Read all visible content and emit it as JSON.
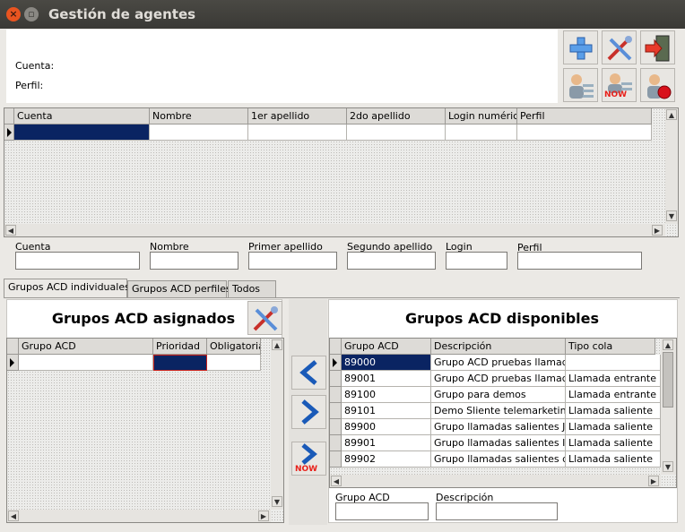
{
  "window": {
    "title": "Gestión de agentes"
  },
  "header": {
    "cuenta_label": "Cuenta:",
    "perfil_label": "Perfil:",
    "now_badge": "NOW"
  },
  "agents_table": {
    "columns": [
      "Cuenta",
      "Nombre",
      "1er apellido",
      "2do apellido",
      "Login numéric",
      "Perfil"
    ]
  },
  "filters": {
    "labels": [
      "Cuenta",
      "Nombre",
      "Primer apellido",
      "Segundo apellido",
      "Login",
      "Perfil"
    ]
  },
  "tabs": [
    "Grupos ACD individuales",
    "Grupos ACD perfiles",
    "Todos"
  ],
  "assigned": {
    "title": "Grupos ACD asignados",
    "columns": [
      "Grupo ACD",
      "Prioridad",
      "Obligatoria"
    ]
  },
  "available": {
    "title": "Grupos ACD disponibles",
    "columns": [
      "Grupo ACD",
      "Descripción",
      "Tipo cola"
    ],
    "rows": [
      [
        "89000",
        "Grupo ACD pruebas llamada",
        ""
      ],
      [
        "89001",
        "Grupo ACD pruebas llamada",
        "Llamada entrante"
      ],
      [
        "89100",
        "Grupo para demos",
        "Llamada entrante"
      ],
      [
        "89101",
        "Demo Sliente telemarketing",
        "Llamada saliente"
      ],
      [
        "89900",
        "Grupo llamadas salientes JA",
        "Llamada saliente"
      ],
      [
        "89901",
        "Grupo llamadas salientes Iv",
        "Llamada saliente"
      ],
      [
        "89902",
        "Grupo llamadas salientes d",
        "Llamada saliente"
      ]
    ],
    "filter_labels": [
      "Grupo ACD",
      "Descripción"
    ]
  },
  "colors": {
    "selection": "#0a2462",
    "accent_red": "#e95420"
  }
}
